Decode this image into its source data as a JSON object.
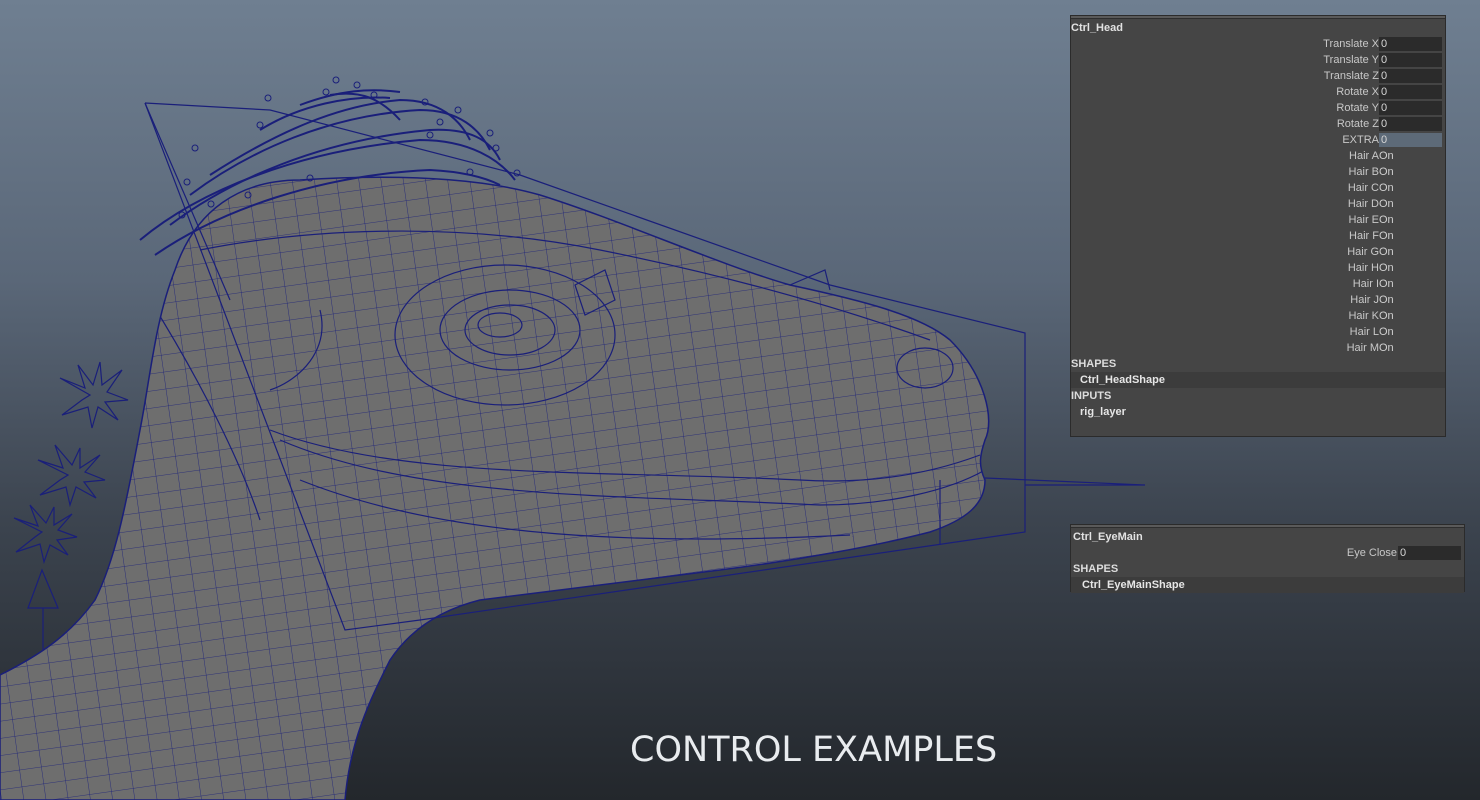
{
  "head_panel": {
    "node_name": "Ctrl_Head",
    "attributes": [
      {
        "label": "Translate X",
        "value": "0"
      },
      {
        "label": "Translate Y",
        "value": "0"
      },
      {
        "label": "Translate Z",
        "value": "0"
      },
      {
        "label": "Rotate X",
        "value": "0"
      },
      {
        "label": "Rotate Y",
        "value": "0"
      },
      {
        "label": "Rotate Z",
        "value": "0"
      },
      {
        "label": "EXTRA",
        "value": "0"
      },
      {
        "label": "Hair A",
        "value": "On"
      },
      {
        "label": "Hair B",
        "value": "On"
      },
      {
        "label": "Hair C",
        "value": "On"
      },
      {
        "label": "Hair D",
        "value": "On"
      },
      {
        "label": "Hair E",
        "value": "On"
      },
      {
        "label": "Hair F",
        "value": "On"
      },
      {
        "label": "Hair G",
        "value": "On"
      },
      {
        "label": "Hair H",
        "value": "On"
      },
      {
        "label": "Hair I",
        "value": "On"
      },
      {
        "label": "Hair J",
        "value": "On"
      },
      {
        "label": "Hair K",
        "value": "On"
      },
      {
        "label": "Hair L",
        "value": "On"
      },
      {
        "label": "Hair M",
        "value": "On"
      }
    ],
    "shapes_header": "SHAPES",
    "shape_name": "Ctrl_HeadShape",
    "inputs_header": "INPUTS",
    "input_name": "rig_layer"
  },
  "eye_panel": {
    "node_name": "Ctrl_EyeMain",
    "attribute": {
      "label": "Eye Close",
      "value": "0"
    },
    "shapes_header": "SHAPES",
    "shape_name": "Ctrl_EyeMainShape"
  },
  "caption": "CONTROL EXAMPLES",
  "colors": {
    "wireframe": "#1a1f7a",
    "mesh_fill": "#6e6e6e",
    "panel_bg": "#454545",
    "field_bg": "#2b2b2b",
    "field_highlight": "#5d6a78"
  }
}
